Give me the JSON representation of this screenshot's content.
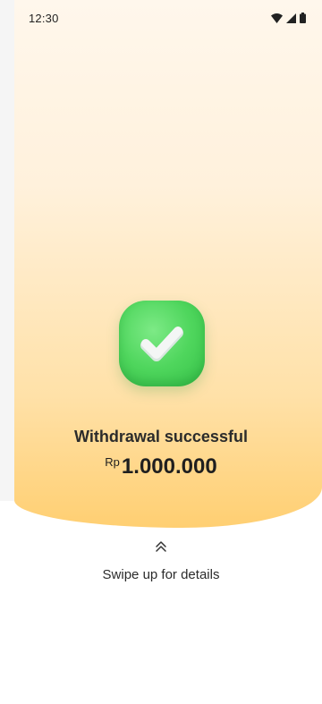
{
  "status_bar": {
    "time": "12:30",
    "icons": [
      "wifi-icon",
      "signal-icon",
      "battery-icon"
    ]
  },
  "result": {
    "icon": "check-icon",
    "title": "Withdrawal successful",
    "currency": "Rp",
    "amount": "1.000.000"
  },
  "footer": {
    "icon": "double-chevron-up-icon",
    "hint": "Swipe up for details"
  },
  "colors": {
    "gradient_top": "#fff7ec",
    "gradient_bottom": "#ffcf72",
    "success_green": "#4fd65d",
    "text": "#2b2b2b"
  }
}
